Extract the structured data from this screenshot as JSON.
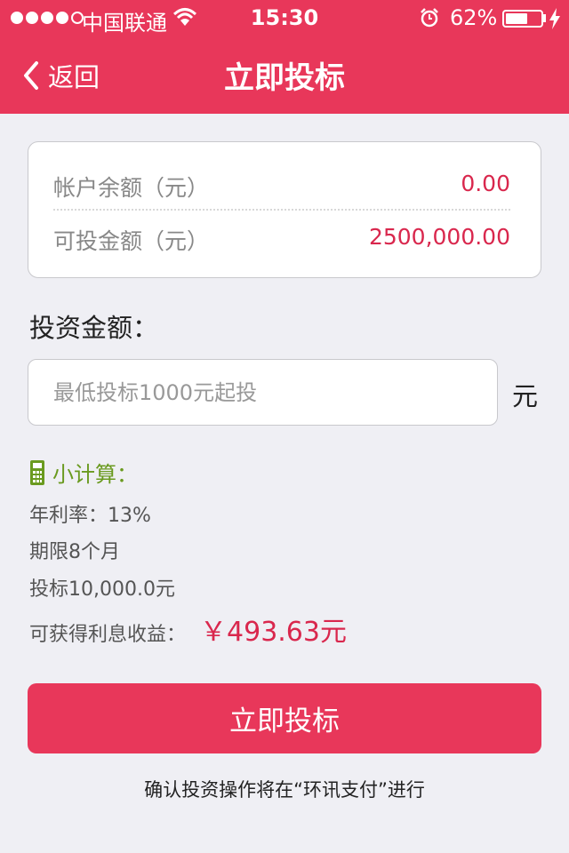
{
  "status_bar": {
    "carrier": "中国联通",
    "time": "15:30",
    "battery_percent": "62%",
    "battery_level": 0.62,
    "signal_bars_filled": 4,
    "signal_bars_total": 5
  },
  "nav": {
    "back_label": "返回",
    "title": "立即投标"
  },
  "balance": {
    "account_label": "帐户余额（元）",
    "account_value": "0.00",
    "investable_label": "可投金额（元）",
    "investable_value": "2500,000.00"
  },
  "form": {
    "amount_label": "投资金额：",
    "amount_placeholder": "最低投标1000元起投",
    "amount_value": "",
    "unit": "元"
  },
  "calculator": {
    "title": "小计算：",
    "rate": "年利率：13%",
    "term": "期限8个月",
    "bid": "投标10,000.0元",
    "income_label": "可获得利息收益：",
    "income_value": "￥493.63元"
  },
  "submit_label": "立即投标",
  "footnote": "确认投资操作将在“环讯支付”进行",
  "colors": {
    "primary": "#e8375a",
    "highlight": "#d9274d",
    "calc_green": "#6a9a1f",
    "background": "#efeff4"
  }
}
